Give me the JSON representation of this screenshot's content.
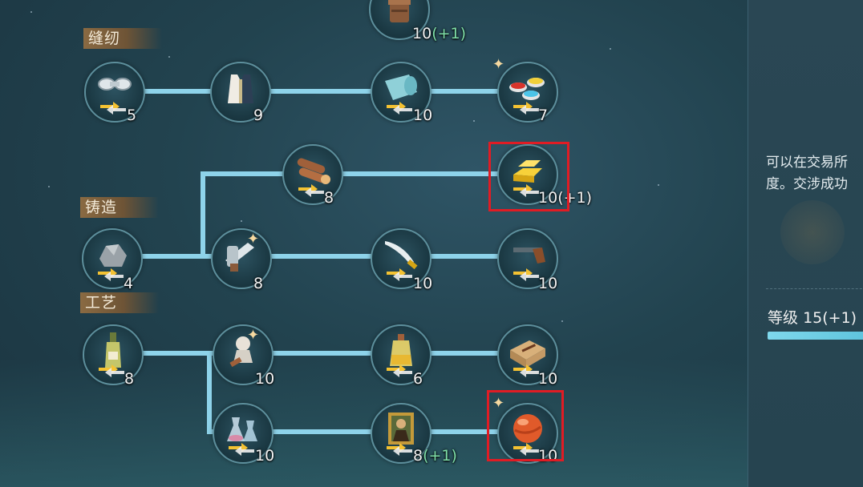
{
  "categories": {
    "sewing": "缝纫",
    "forging": "铸造",
    "crafts": "工艺"
  },
  "nodes": {
    "top": {
      "icon": "barrel-icon",
      "count": "10",
      "bonus": "(+1)"
    },
    "spool": {
      "icon": "thread-spool-icon",
      "count": "5"
    },
    "vest": {
      "icon": "vest-icon",
      "count": "9"
    },
    "cloth": {
      "icon": "cloth-roll-icon",
      "count": "10"
    },
    "dyes": {
      "icon": "dye-bowls-icon",
      "count": "7"
    },
    "wood": {
      "icon": "timber-icon",
      "count": "8"
    },
    "gold": {
      "icon": "gold-bars-icon",
      "count": "10",
      "bonus": "(+1)"
    },
    "ore": {
      "icon": "ore-icon",
      "count": "4"
    },
    "sword": {
      "icon": "sword-icon",
      "count": "8"
    },
    "saber": {
      "icon": "saber-icon",
      "count": "10"
    },
    "pistol": {
      "icon": "pistol-icon",
      "count": "10"
    },
    "wine": {
      "icon": "wine-bottle-icon",
      "count": "8"
    },
    "statue": {
      "icon": "statue-bust-icon",
      "count": "10"
    },
    "oil": {
      "icon": "oil-jar-icon",
      "count": "6"
    },
    "cigars": {
      "icon": "cigar-crate-icon",
      "count": "10"
    },
    "vases": {
      "icon": "glass-vases-icon",
      "count": "10"
    },
    "painting": {
      "icon": "mona-lisa-painting-icon",
      "count": "8",
      "bonus": "(+1)"
    },
    "gem": {
      "icon": "orange-gem-icon",
      "count": "10"
    }
  },
  "panel": {
    "desc_line1": "可以在交易所",
    "desc_line2": "度。交涉成功",
    "level_label": "等级",
    "level_value": "15(+1)",
    "level_progress": 0.95
  },
  "colors": {
    "connector": "#8ed3ea",
    "highlight": "#e01c24",
    "bonus": "#7fe0a8"
  }
}
